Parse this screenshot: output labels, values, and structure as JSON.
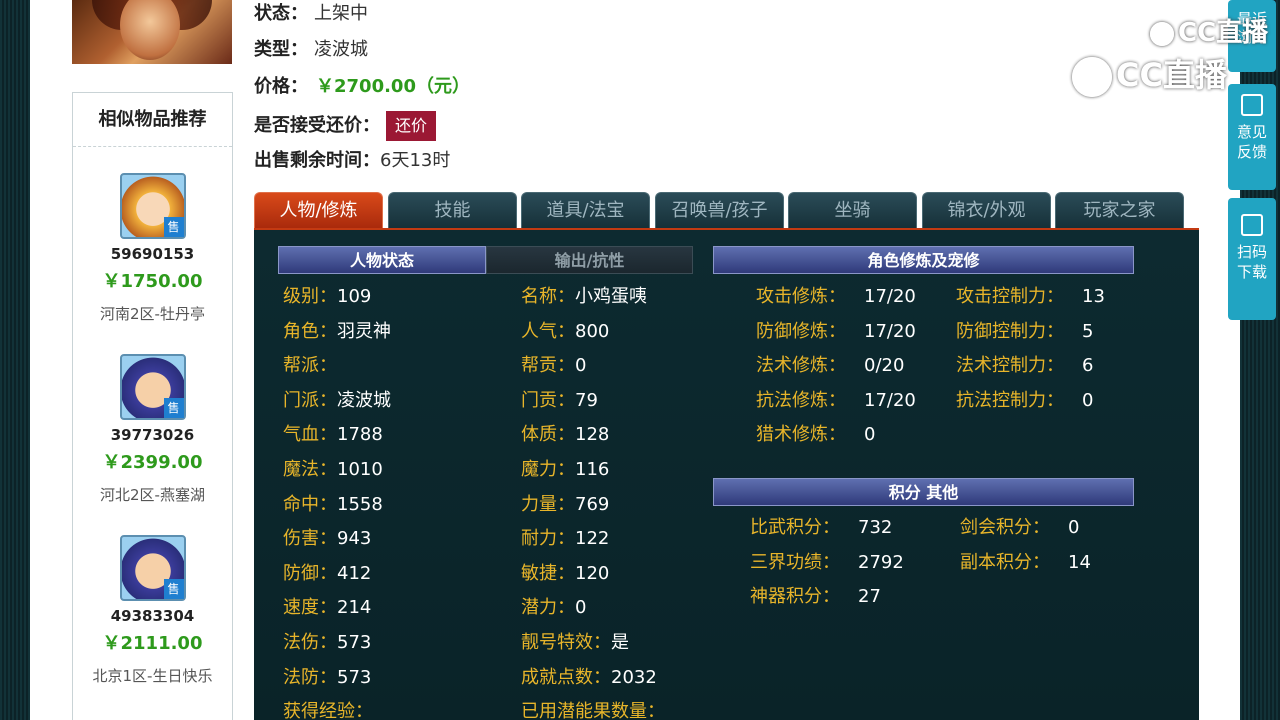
{
  "info": {
    "status_label": "状态：",
    "status_value": "上架中",
    "type_label": "类型：",
    "type_value": "凌波城",
    "price_label": "价格：",
    "price_value": "￥2700.00（元）",
    "bargain_label": "是否接受还价：",
    "bargain_button": "还价",
    "remaining_label": "出售剩余时间：",
    "remaining_value": "6天13时"
  },
  "similar": {
    "title": "相似物品推荐",
    "sale_tag": "售",
    "items": [
      {
        "id": "59690153",
        "price": "￥1750.00",
        "server": "河南2区-牡丹亭"
      },
      {
        "id": "39773026",
        "price": "￥2399.00",
        "server": "河北2区-燕塞湖"
      },
      {
        "id": "49383304",
        "price": "￥2111.00",
        "server": "北京1区-生日快乐"
      }
    ]
  },
  "tabs": [
    "人物/修炼",
    "技能",
    "道具/法宝",
    "召唤兽/孩子",
    "坐骑",
    "锦衣/外观",
    "玩家之家"
  ],
  "panel": {
    "bar_status": "人物状态",
    "bar_output": "输出/抗性",
    "bar_cultivation": "角色修炼及宠修",
    "bar_points": "积分 其他",
    "left_col": [
      {
        "k": "级别：",
        "v": "109"
      },
      {
        "k": "角色：",
        "v": "羽灵神"
      },
      {
        "k": "帮派：",
        "v": ""
      },
      {
        "k": "门派：",
        "v": "凌波城"
      },
      {
        "k": "气血：",
        "v": "1788"
      },
      {
        "k": "魔法：",
        "v": "1010"
      },
      {
        "k": "命中：",
        "v": "1558"
      },
      {
        "k": "伤害：",
        "v": "943"
      },
      {
        "k": "防御：",
        "v": "412"
      },
      {
        "k": "速度：",
        "v": "214"
      },
      {
        "k": "法伤：",
        "v": "573"
      },
      {
        "k": "法防：",
        "v": "573"
      },
      {
        "k": "获得经验：",
        "v": ""
      }
    ],
    "mid_col": [
      {
        "k": "名称：",
        "v": "小鸡蛋咦"
      },
      {
        "k": "人气：",
        "v": "800"
      },
      {
        "k": "帮贡：",
        "v": "0"
      },
      {
        "k": "门贡：",
        "v": "79"
      },
      {
        "k": "体质：",
        "v": "128"
      },
      {
        "k": "魔力：",
        "v": "116"
      },
      {
        "k": "力量：",
        "v": "769"
      },
      {
        "k": "耐力：",
        "v": "122"
      },
      {
        "k": "敏捷：",
        "v": "120"
      },
      {
        "k": "潜力：",
        "v": "0"
      },
      {
        "k": "靓号特效：",
        "v": "是"
      },
      {
        "k": "成就点数：",
        "v": "2032"
      },
      {
        "k": "已用潜能果数量：",
        "v": ""
      }
    ],
    "cultivation": [
      {
        "k": "攻击修炼：",
        "v": "17/20",
        "k2": "攻击控制力：",
        "v2": "13"
      },
      {
        "k": "防御修炼：",
        "v": "17/20",
        "k2": "防御控制力：",
        "v2": "5"
      },
      {
        "k": "法术修炼：",
        "v": "0/20",
        "k2": "法术控制力：",
        "v2": "6"
      },
      {
        "k": "抗法修炼：",
        "v": "17/20",
        "k2": "抗法控制力：",
        "v2": "0"
      },
      {
        "k": "猎术修炼：",
        "v": "0",
        "k2": "",
        "v2": ""
      }
    ],
    "points": [
      {
        "k": "比武积分：",
        "v": "732",
        "k2": "剑会积分：",
        "v2": "0"
      },
      {
        "k": "三界功绩：",
        "v": "2792",
        "k2": "副本积分：",
        "v2": "14"
      },
      {
        "k": "神器积分：",
        "v": "27",
        "k2": "",
        "v2": ""
      }
    ]
  },
  "side": {
    "recent": "最近浏览",
    "feedback_1": "意见",
    "feedback_2": "反馈",
    "scan_1": "扫码",
    "scan_2": "下载"
  },
  "watermark": "CC直播"
}
